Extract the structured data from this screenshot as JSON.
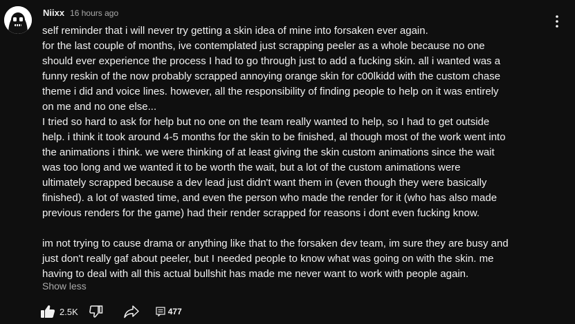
{
  "comment": {
    "author": "Niixx",
    "timestamp": "16 hours ago",
    "paragraph1_lines": [
      "self reminder that i will never try getting a skin idea of mine into forsaken ever again.",
      "for the last couple of months, ive contemplated just scrapping peeler as a whole because no one",
      "should ever experience the process I had to go through just to add a fucking skin. all i wanted was a",
      "funny reskin of the now probably scrapped annoying orange skin for c00lkidd with the custom chase",
      "theme i did and voice lines. however, all the responsibility of finding people to help on it was entirely",
      "on me and no one else...",
      "I tried so hard to ask for help but no one on the team really wanted to help, so I had to get outside",
      "help. i think it took around 4-5 months for the skin to be finished, al though most of the work went into",
      "the animations i think. we were thinking of at least giving the skin custom animations since the wait",
      "was too long and we wanted it to be worth the wait, but a lot of the custom animations were",
      "ultimately scrapped because a dev lead just didn't want them in (even though they were basically",
      "finished). a lot of wasted time, and even the person who made the render for it (who has also made",
      "previous renders for the game) had their render scrapped for reasons i dont even fucking know."
    ],
    "paragraph2_lines": [
      "im not trying to cause drama or anything like that to the forsaken dev team, im sure they are busy and",
      "just don't really gaf about peeler, but I needed people to know what was going on with the skin. me",
      "having to deal with all this actual bullshit has made me never want to work with people again."
    ],
    "show_less_label": "Show less"
  },
  "toolbar": {
    "like_count": "2.5K",
    "reply_count": "477"
  },
  "icons": {
    "menu": "vertical-ellipsis-icon",
    "like": "thumbs-up-icon",
    "dislike": "thumbs-down-icon",
    "share": "share-arrow-icon",
    "replies": "comment-replies-icon"
  },
  "colors": {
    "background": "#0f0f0f",
    "text": "#f1f1f1",
    "secondary_text": "#aaaaaa"
  }
}
